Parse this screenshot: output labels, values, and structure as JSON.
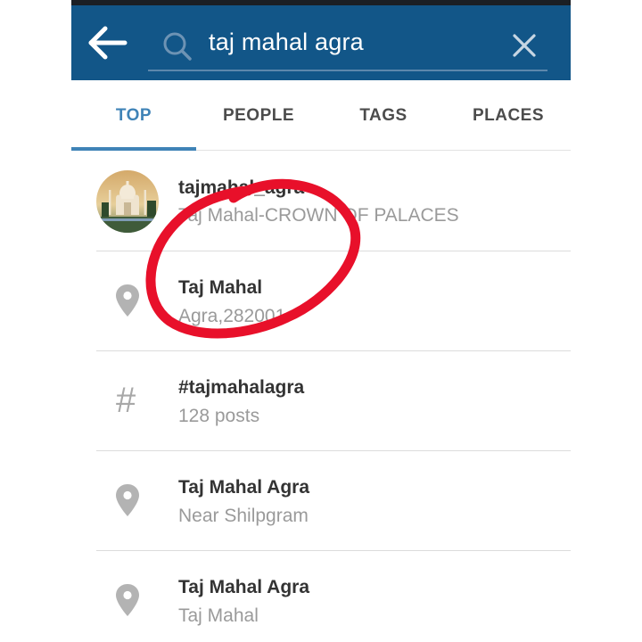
{
  "search": {
    "query": "taj mahal agra"
  },
  "tabs": [
    {
      "label": "TOP",
      "active": true
    },
    {
      "label": "PEOPLE",
      "active": false
    },
    {
      "label": "TAGS",
      "active": false
    },
    {
      "label": "PLACES",
      "active": false
    }
  ],
  "results": [
    {
      "type": "user",
      "icon": "avatar",
      "title": "tajmahal_agra",
      "subtitle": "Taj Mahal-CROWN OF PALACES"
    },
    {
      "type": "place",
      "icon": "location-pin-icon",
      "title": "Taj Mahal",
      "subtitle": "Agra,282001"
    },
    {
      "type": "tag",
      "icon": "hashtag-icon",
      "title": "#tajmahalagra",
      "subtitle": "128 posts"
    },
    {
      "type": "place",
      "icon": "location-pin-icon",
      "title": "Taj Mahal Agra",
      "subtitle": "Near Shilpgram"
    },
    {
      "type": "place",
      "icon": "location-pin-icon",
      "title": "Taj Mahal Agra",
      "subtitle": "Taj Mahal"
    }
  ],
  "hash_glyph": "#",
  "colors": {
    "header": "#125688",
    "active_tab": "#3f83b7",
    "annotation": "#e8102a"
  }
}
